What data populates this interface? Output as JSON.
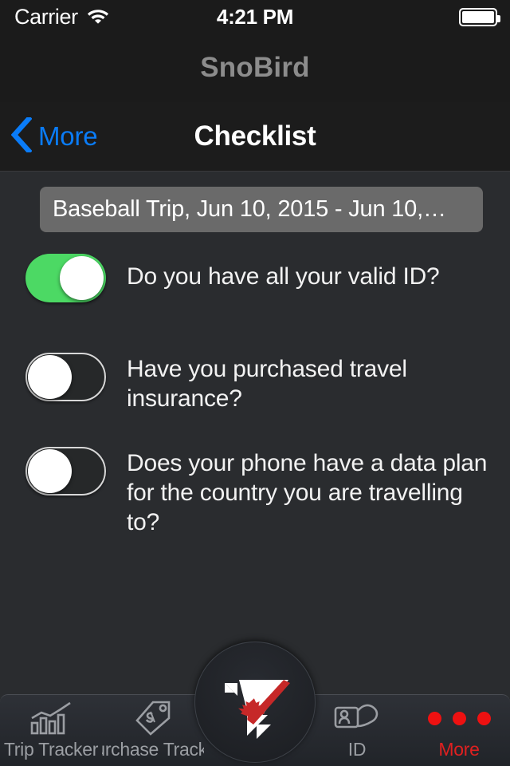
{
  "status_bar": {
    "carrier": "Carrier",
    "wifi_icon": "wifi-icon",
    "time": "4:21 PM",
    "battery_icon": "battery-full-icon"
  },
  "app_header": {
    "title": "SnoBird"
  },
  "nav_bar": {
    "back_icon": "chevron-left-icon",
    "back_label": "More",
    "title": "Checklist",
    "accent_color": "#0a7cf8"
  },
  "trip_selector": {
    "value": "Baseball Trip, Jun 10, 2015 - Jun 10,…"
  },
  "checklist": {
    "items": [
      {
        "label": "Do you have all your valid ID?",
        "checked": true
      },
      {
        "label": "Have you purchased travel insurance?",
        "checked": false
      },
      {
        "label": "Does your phone have a data plan for the country you are travelling to?",
        "checked": false
      }
    ],
    "toggle_on_color": "#4cd964"
  },
  "tab_bar": {
    "tabs": [
      {
        "label": "Trip Tracker",
        "icon": "bar-chart-icon",
        "active": false
      },
      {
        "label": "Purchase Tracker",
        "icon": "price-tag-icon",
        "active": false
      },
      {
        "label": "ID",
        "icon": "id-card-hand-icon",
        "active": false
      },
      {
        "label": "More",
        "icon": "three-dots-icon",
        "active": true
      }
    ],
    "center_button_icon": "snobird-logo-icon",
    "active_color": "#e02020"
  }
}
